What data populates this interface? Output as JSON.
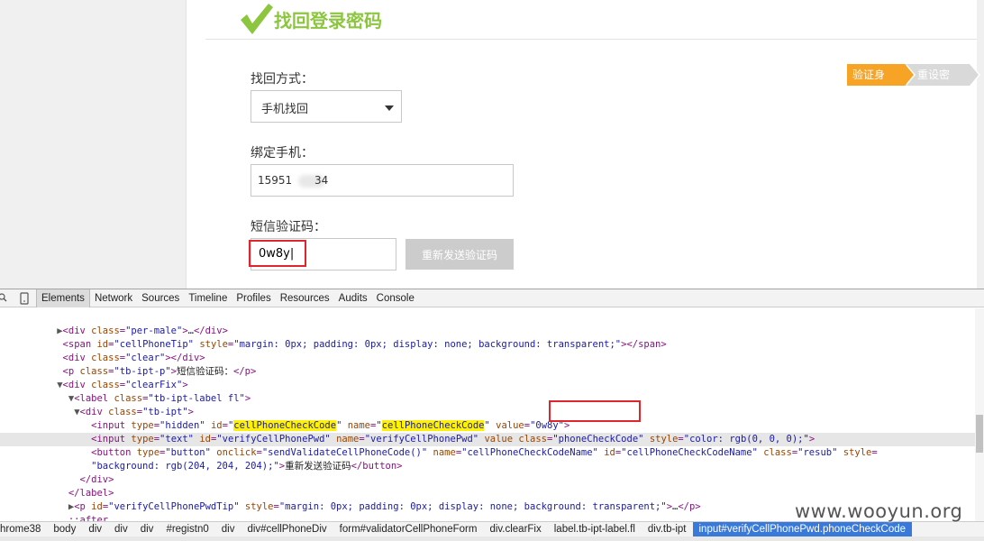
{
  "page": {
    "title": "找回登录密码",
    "steps": [
      "验证身份",
      "重设密码"
    ],
    "method_label": "找回方式：",
    "method_value": "手机找回",
    "phone_label": "绑定手机：",
    "phone_prefix": "15951",
    "phone_suffix": "34",
    "sms_label": "短信验证码：",
    "sms_value": "0w8y|",
    "resend_button": "重新发送验证码"
  },
  "devtools": {
    "tabs": [
      "Elements",
      "Network",
      "Sources",
      "Timeline",
      "Profiles",
      "Resources",
      "Audits",
      "Console"
    ],
    "active_tab": "Elements",
    "breadcrumb": [
      "hrome38",
      "body",
      "div",
      "div",
      "div",
      "#registn0",
      "div",
      "div#cellPhoneDiv",
      "form#validatorCellPhoneForm",
      "div.clearFix",
      "label.tb-ipt-label.fl",
      "div.tb-ipt",
      "input#verifyCellPhonePwd.phoneCheckCode"
    ]
  },
  "colors": {
    "accent_green": "#8cc63e",
    "step_active": "#f7a325",
    "step_inactive": "#d9d9d9",
    "highlight": "#e0262d",
    "breadcrumb_active": "#3879d9"
  },
  "watermark": "www.wooyun.org"
}
